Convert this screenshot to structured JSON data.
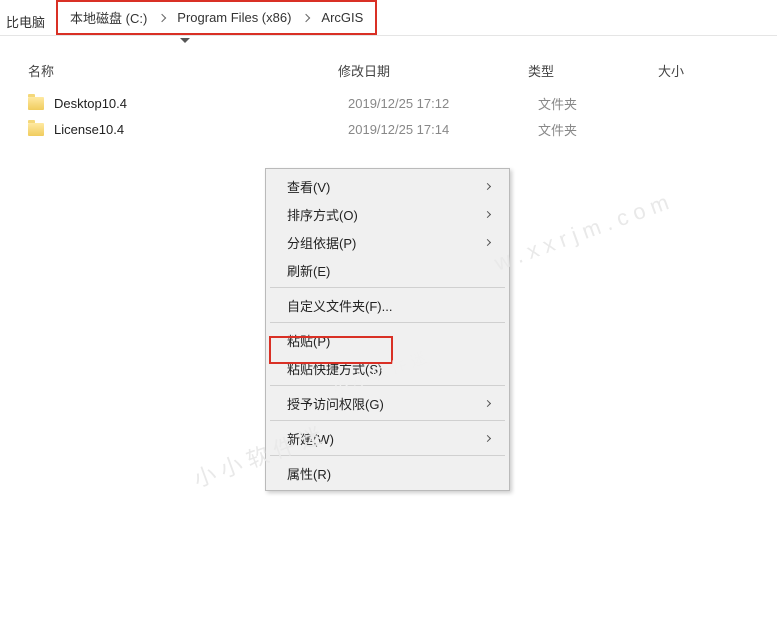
{
  "breadcrumb": {
    "root": "比电脑",
    "parts": [
      "本地磁盘 (C:)",
      "Program Files (x86)",
      "ArcGIS"
    ]
  },
  "columns": {
    "name": "名称",
    "date": "修改日期",
    "type": "类型",
    "size": "大小"
  },
  "files": [
    {
      "name": "Desktop10.4",
      "date": "2019/12/25 17:12",
      "type": "文件夹"
    },
    {
      "name": "License10.4",
      "date": "2019/12/25 17:14",
      "type": "文件夹"
    }
  ],
  "menu": {
    "view": "查看(V)",
    "sort": "排序方式(O)",
    "group": "分组依据(P)",
    "refresh": "刷新(E)",
    "customize": "自定义文件夹(F)...",
    "paste": "粘贴(P)",
    "paste_shortcut": "粘贴快捷方式(S)",
    "grant_access": "授予访问权限(G)",
    "new": "新建(W)",
    "properties": "属性(R)"
  },
  "watermarks": {
    "w1": "w . x x r j m . c o m",
    "w2": "小 小 软 件 迷",
    "w3": "小 小 软 件 迷"
  }
}
